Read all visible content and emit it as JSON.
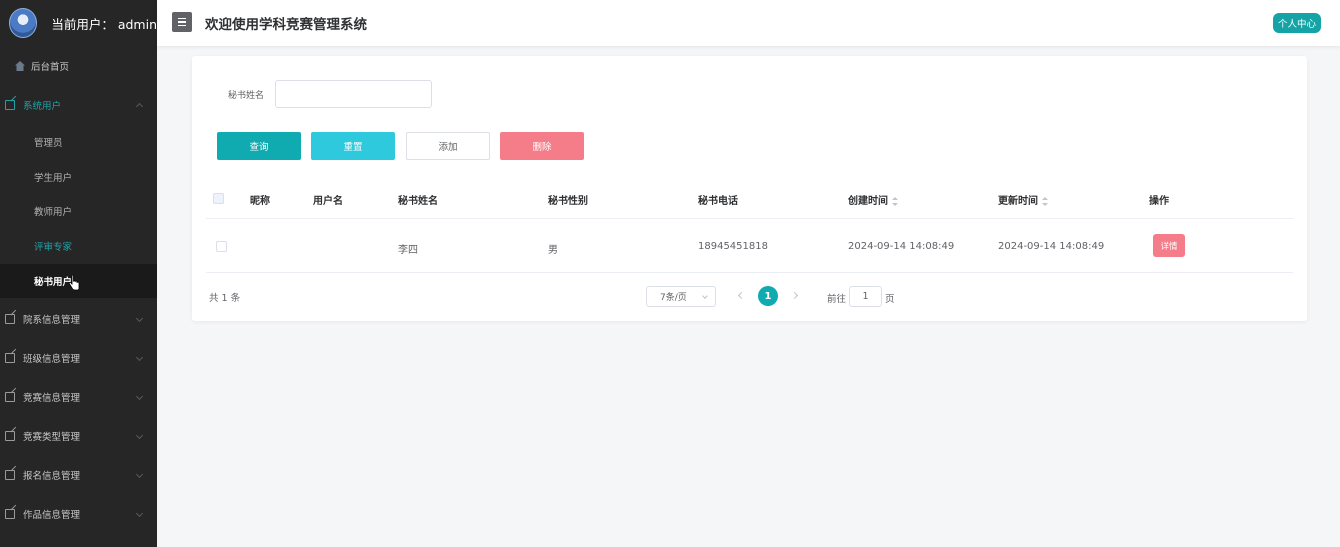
{
  "sidebar": {
    "user_prefix": "当前用户：",
    "username": "admin",
    "home": "后台首页",
    "groups": [
      {
        "label": "系统用户",
        "children": [
          "管理员",
          "学生用户",
          "教师用户",
          "评审专家",
          "秘书用户"
        ]
      },
      {
        "label": "院系信息管理"
      },
      {
        "label": "班级信息管理"
      },
      {
        "label": "竞赛信息管理"
      },
      {
        "label": "竞赛类型管理"
      },
      {
        "label": "报名信息管理"
      },
      {
        "label": "作品信息管理"
      }
    ]
  },
  "header": {
    "title": "欢迎使用学科竞赛管理系统",
    "profile_button": "个人中心"
  },
  "search": {
    "label": "秘书姓名",
    "value": ""
  },
  "actions": {
    "query": "查询",
    "reset": "重置",
    "add": "添加",
    "delete": "删除"
  },
  "table": {
    "columns": [
      "昵称",
      "用户名",
      "秘书姓名",
      "秘书性别",
      "秘书电话",
      "创建时间",
      "更新时间",
      "操作"
    ],
    "rows": [
      {
        "nickname": "",
        "username": "",
        "name": "李四",
        "gender": "男",
        "phone": "18945451818",
        "created": "2024-09-14 14:08:49",
        "updated": "2024-09-14 14:08:49",
        "action": "详情"
      }
    ]
  },
  "pagination": {
    "total": "共 1 条",
    "page_size": "7条/页",
    "current_page": "1",
    "goto_prefix": "前往",
    "goto_value": "1",
    "goto_suffix": "页"
  },
  "colors": {
    "accent": "#10abb0",
    "reset": "#2ec9dc",
    "danger": "#f57d8a",
    "sidebar_bg": "#262626"
  }
}
